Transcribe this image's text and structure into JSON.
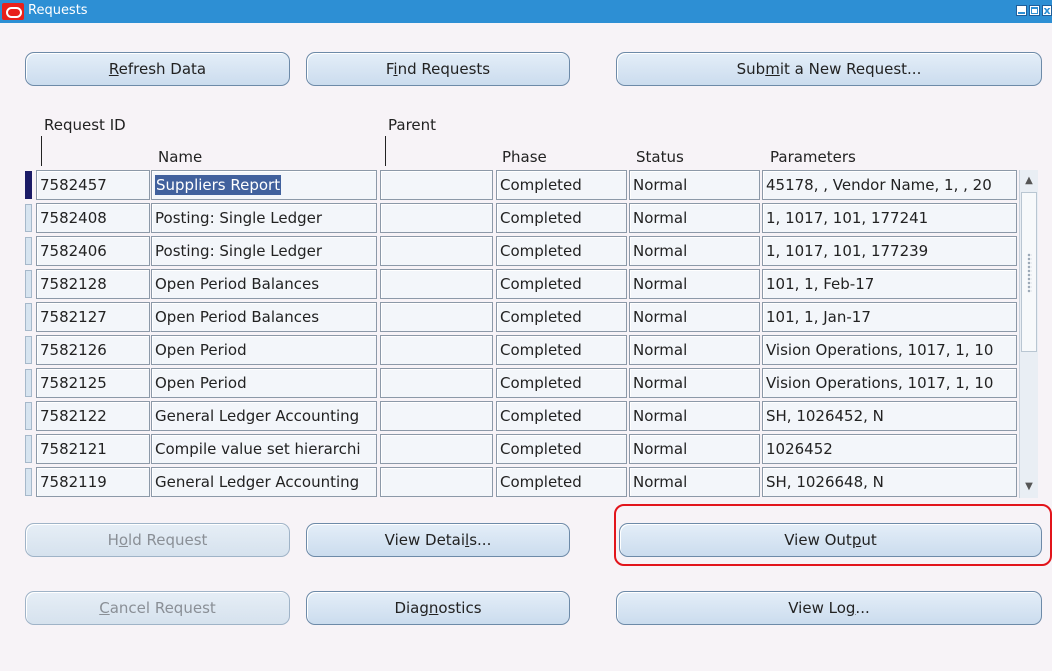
{
  "window": {
    "title": "Requests"
  },
  "buttons": {
    "refresh": {
      "pre": "",
      "u": "R",
      "post": "efresh Data"
    },
    "find": {
      "pre": "F",
      "u": "i",
      "post": "nd Requests"
    },
    "submit": {
      "pre": "Sub",
      "u": "m",
      "post": "it a New Request..."
    },
    "hold": {
      "pre": "H",
      "u": "o",
      "post": "ld Request"
    },
    "view_details": {
      "pre": "View Detai",
      "u": "l",
      "post": "s..."
    },
    "view_output": {
      "pre": "View Out",
      "u": "p",
      "post": "ut"
    },
    "cancel": {
      "pre": "",
      "u": "C",
      "post": "ancel Request"
    },
    "diagnostics": {
      "pre": "Diag",
      "u": "n",
      "post": "ostics"
    },
    "view_log": {
      "pre": "View Lo",
      "u": "g",
      "post": "..."
    }
  },
  "table": {
    "headers": {
      "request_id": "Request ID",
      "parent": "Parent",
      "name": "Name",
      "phase": "Phase",
      "status": "Status",
      "parameters": "Parameters"
    },
    "rows": [
      {
        "id": "7582457",
        "name": "Suppliers Report",
        "parent": "",
        "phase": "Completed",
        "status": "Normal",
        "params": "45178, , Vendor Name, 1, , 20"
      },
      {
        "id": "7582408",
        "name": "Posting: Single Ledger",
        "parent": "",
        "phase": "Completed",
        "status": "Normal",
        "params": "1, 1017, 101, 177241"
      },
      {
        "id": "7582406",
        "name": "Posting: Single Ledger",
        "parent": "",
        "phase": "Completed",
        "status": "Normal",
        "params": "1, 1017, 101, 177239"
      },
      {
        "id": "7582128",
        "name": "Open Period Balances",
        "parent": "",
        "phase": "Completed",
        "status": "Normal",
        "params": "101, 1, Feb-17"
      },
      {
        "id": "7582127",
        "name": "Open Period Balances",
        "parent": "",
        "phase": "Completed",
        "status": "Normal",
        "params": "101, 1, Jan-17"
      },
      {
        "id": "7582126",
        "name": "Open Period",
        "parent": "",
        "phase": "Completed",
        "status": "Normal",
        "params": "Vision Operations, 1017, 1, 10"
      },
      {
        "id": "7582125",
        "name": "Open Period",
        "parent": "",
        "phase": "Completed",
        "status": "Normal",
        "params": "Vision Operations, 1017, 1, 10"
      },
      {
        "id": "7582122",
        "name": "General Ledger Accounting",
        "parent": "",
        "phase": "Completed",
        "status": "Normal",
        "params": "SH, 1026452, N"
      },
      {
        "id": "7582121",
        "name": "Compile value set hierarchi",
        "parent": "",
        "phase": "Completed",
        "status": "Normal",
        "params": "1026452"
      },
      {
        "id": "7582119",
        "name": "General Ledger Accounting",
        "parent": "",
        "phase": "Completed",
        "status": "Normal",
        "params": "SH, 1026648, N"
      }
    ]
  },
  "colors": {
    "titlebar": "#2d8fd4",
    "highlight": "#e2141b",
    "selection": "#41619d"
  }
}
